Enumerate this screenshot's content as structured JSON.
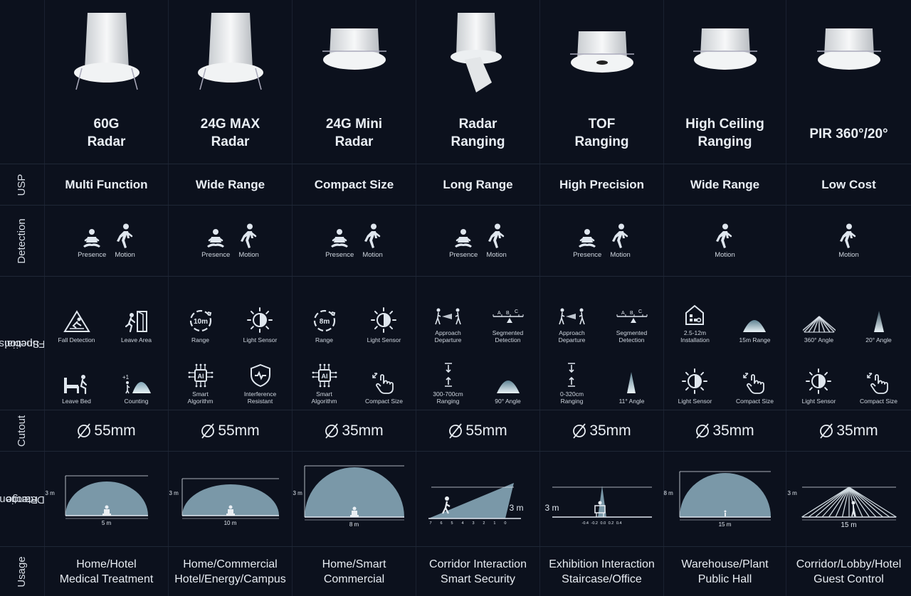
{
  "row_labels": {
    "usp": "USP",
    "detection": "Detection",
    "special_functions": [
      "Special",
      "Functions"
    ],
    "cutout": "Cutout",
    "detection_range": [
      "Detection",
      "Range"
    ],
    "usage": "Usage"
  },
  "products": [
    {
      "name": [
        "60G",
        "Radar"
      ],
      "usp": "Multi Function",
      "detection": [
        "Presence",
        "Motion"
      ],
      "functions": [
        [
          "Fall Detection"
        ],
        [
          "Leave Area"
        ],
        [
          "Leave Bed"
        ],
        [
          "Counting"
        ]
      ],
      "cutout": "55mm",
      "range": {
        "height": "3 m",
        "width": "5 m"
      },
      "usage": [
        "Home/Hotel",
        "Medical Treatment"
      ]
    },
    {
      "name": [
        "24G MAX",
        "Radar"
      ],
      "usp": "Wide Range",
      "detection": [
        "Presence",
        "Motion"
      ],
      "functions": [
        [
          "Range"
        ],
        [
          "Light Sensor"
        ],
        [
          "Smart",
          "Algorithm"
        ],
        [
          "Interference",
          "Resistant"
        ]
      ],
      "cutout": "55mm",
      "range": {
        "height": "3 m",
        "width": "10 m"
      },
      "usage": [
        "Home/Commercial",
        "Hotel/Energy/Campus"
      ]
    },
    {
      "name": [
        "24G Mini",
        "Radar"
      ],
      "usp": "Compact Size",
      "detection": [
        "Presence",
        "Motion"
      ],
      "functions": [
        [
          "Range"
        ],
        [
          "Light Sensor"
        ],
        [
          "Smart",
          "Algorithm"
        ],
        [
          "Compact Size"
        ]
      ],
      "cutout": "35mm",
      "range": {
        "height": "3 m",
        "width": "8 m"
      },
      "usage": [
        "Home/Smart",
        "Commercial"
      ]
    },
    {
      "name": [
        "Radar",
        "Ranging"
      ],
      "usp": "Long Range",
      "detection": [
        "Presence",
        "Motion"
      ],
      "functions": [
        [
          "Approach",
          "Departure"
        ],
        [
          "Segmented",
          "Detection"
        ],
        [
          "300-700cm",
          "Ranging"
        ],
        [
          "90° Angle"
        ]
      ],
      "cutout": "55mm",
      "range": {
        "height": "3 m",
        "width": "",
        "ticks": [
          "7",
          "6",
          "5",
          "4",
          "3",
          "2",
          "1",
          "0"
        ]
      },
      "usage": [
        "Corridor Interaction",
        "Smart Security"
      ]
    },
    {
      "name": [
        "TOF",
        "Ranging"
      ],
      "usp": "High Precision",
      "detection": [
        "Presence",
        "Motion"
      ],
      "functions": [
        [
          "Approach",
          "Departure"
        ],
        [
          "Segmented",
          "Detection"
        ],
        [
          "0-320cm",
          "Ranging"
        ],
        [
          "11° Angle"
        ]
      ],
      "cutout": "35mm",
      "range": {
        "height": "3 m",
        "width": "",
        "ticks": [
          "-0.4",
          "-0.2",
          "0.0",
          "0.2",
          "0.4"
        ]
      },
      "usage": [
        "Exhibition Interaction",
        "Staircase/Office"
      ]
    },
    {
      "name": [
        "High Ceiling",
        "Ranging"
      ],
      "usp": "Wide Range",
      "detection": [
        "Motion"
      ],
      "functions": [
        [
          "2.5-12m",
          "Installation"
        ],
        [
          "15m Range"
        ],
        [
          "Light Sensor"
        ],
        [
          "Compact Size"
        ]
      ],
      "cutout": "35mm",
      "range": {
        "height": "8 m",
        "width": "15 m"
      },
      "usage": [
        "Warehouse/Plant",
        "Public Hall"
      ]
    },
    {
      "name": [
        "PIR 360°/20°"
      ],
      "usp": "Low Cost",
      "detection": [
        "Motion"
      ],
      "functions": [
        [
          "360° Angle"
        ],
        [
          "20° Angle"
        ],
        [
          "Light Sensor"
        ],
        [
          "Compact Size"
        ]
      ],
      "cutout": "35mm",
      "range": {
        "height": "3 m",
        "width": "15 m"
      },
      "usage": [
        "Corridor/Lobby/Hotel",
        "Guest Control"
      ]
    }
  ],
  "colors": {
    "background": "#0c111d",
    "text": "#e8edf2",
    "range_fill": "#7a98a8",
    "icon": "#dfe6ee"
  }
}
